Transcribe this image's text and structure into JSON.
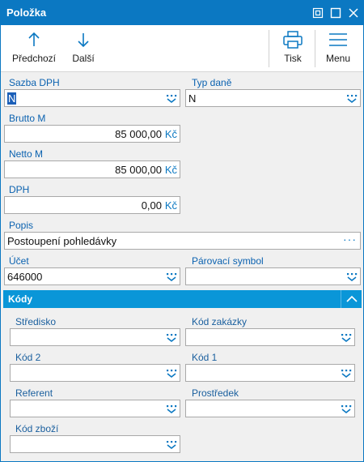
{
  "window": {
    "title": "Položka"
  },
  "toolbar": {
    "prev_label": "Předchozí",
    "next_label": "Další",
    "print_label": "Tisk",
    "menu_label": "Menu"
  },
  "form": {
    "sazba_dph": {
      "label": "Sazba DPH",
      "value": "N"
    },
    "typ_dane": {
      "label": "Typ daně",
      "value": "N"
    },
    "brutto": {
      "label": "Brutto M",
      "value": "85 000,00",
      "unit": "Kč"
    },
    "netto": {
      "label": "Netto M",
      "value": "85 000,00",
      "unit": "Kč"
    },
    "dph": {
      "label": "DPH",
      "value": "0,00",
      "unit": "Kč"
    },
    "popis": {
      "label": "Popis",
      "value": "Postoupení pohledávky"
    },
    "ucet": {
      "label": "Účet",
      "value": "646000"
    },
    "parovaci_symbol": {
      "label": "Párovací symbol",
      "value": ""
    }
  },
  "codes": {
    "title": "Kódy",
    "stredisko": {
      "label": "Středisko",
      "value": ""
    },
    "kod_zakazky": {
      "label": "Kód zakázky",
      "value": ""
    },
    "kod2": {
      "label": "Kód 2",
      "value": ""
    },
    "kod1": {
      "label": "Kód 1",
      "value": ""
    },
    "referent": {
      "label": "Referent",
      "value": ""
    },
    "prostredek": {
      "label": "Prostředek",
      "value": ""
    },
    "kod_zbozi": {
      "label": "Kód zboží",
      "value": ""
    }
  },
  "colors": {
    "titlebar": "#0b78c2",
    "section_header": "#0a96d8",
    "label": "#0b62b0"
  }
}
